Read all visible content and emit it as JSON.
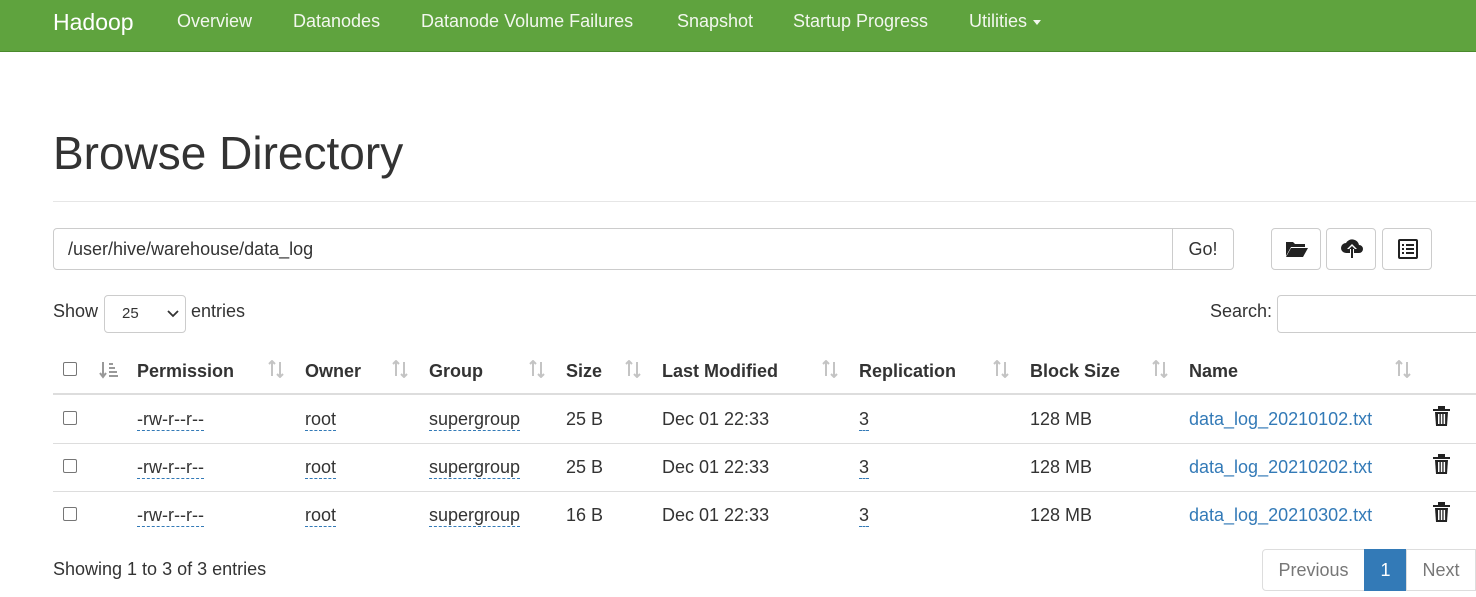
{
  "navbar": {
    "brand": "Hadoop",
    "items": [
      {
        "label": "Overview"
      },
      {
        "label": "Datanodes"
      },
      {
        "label": "Datanode Volume Failures"
      },
      {
        "label": "Snapshot"
      },
      {
        "label": "Startup Progress"
      },
      {
        "label": "Utilities"
      }
    ],
    "color": "#5fa33e"
  },
  "page": {
    "title": "Browse Directory"
  },
  "path_bar": {
    "value": "/user/hive/warehouse/data_log",
    "go_label": "Go!",
    "icons": [
      "folder-open-icon",
      "cloud-upload-icon",
      "list-alt-icon"
    ]
  },
  "controls": {
    "show_label": "Show",
    "entries_value": "25",
    "entries_label": "entries",
    "search_label": "Search:",
    "search_value": ""
  },
  "table": {
    "columns": [
      "Permission",
      "Owner",
      "Group",
      "Size",
      "Last Modified",
      "Replication",
      "Block Size",
      "Name"
    ],
    "rows": [
      {
        "permission": "-rw-r--r--",
        "owner": "root",
        "group": "supergroup",
        "size": "25 B",
        "modified": "Dec 01 22:33",
        "replication": "3",
        "block_size": "128 MB",
        "name": "data_log_20210102.txt"
      },
      {
        "permission": "-rw-r--r--",
        "owner": "root",
        "group": "supergroup",
        "size": "25 B",
        "modified": "Dec 01 22:33",
        "replication": "3",
        "block_size": "128 MB",
        "name": "data_log_20210202.txt"
      },
      {
        "permission": "-rw-r--r--",
        "owner": "root",
        "group": "supergroup",
        "size": "16 B",
        "modified": "Dec 01 22:33",
        "replication": "3",
        "block_size": "128 MB",
        "name": "data_log_20210302.txt"
      }
    ]
  },
  "footer": {
    "info": "Showing 1 to 3 of 3 entries",
    "previous": "Previous",
    "current_page": "1",
    "next": "Next",
    "accent": "#337ab7"
  }
}
